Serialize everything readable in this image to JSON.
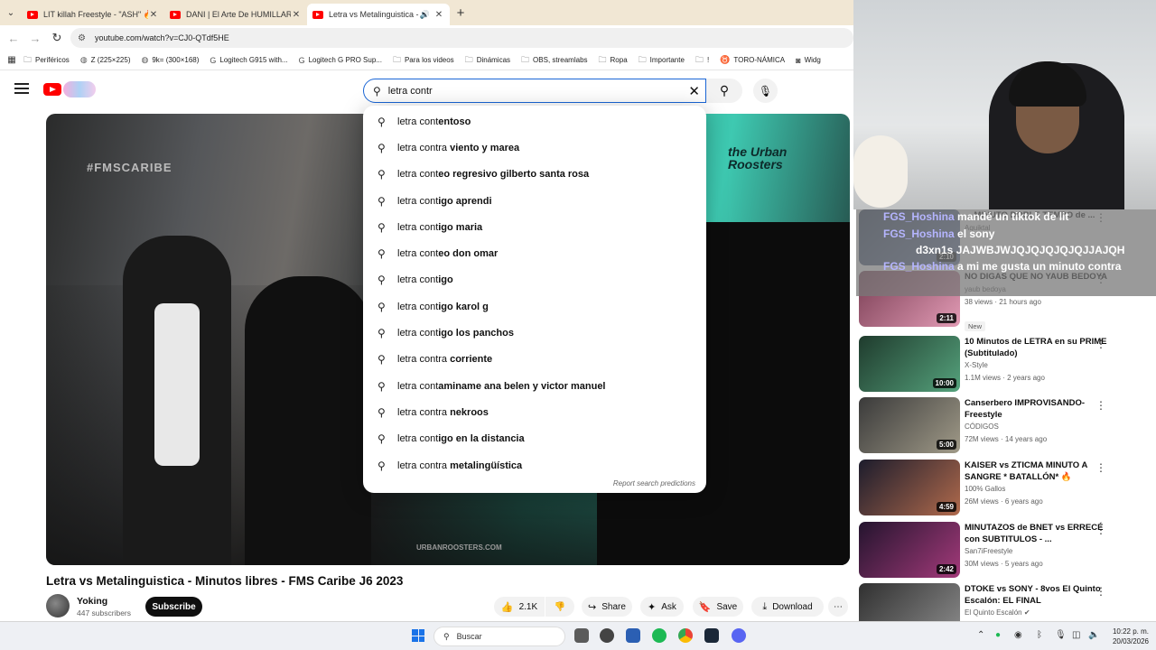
{
  "tabs": [
    {
      "title": "LIT killah Freestyle - \"ASH\" 🔥 -",
      "active": false
    },
    {
      "title": "DANI | El Arte De HUMILLAR Si",
      "active": false
    },
    {
      "title": "Letra vs Metalinguistica - M",
      "active": true
    }
  ],
  "address": {
    "url": "youtube.com/watch?v=CJ0-QTdf5HE"
  },
  "bookmarks": [
    "Periféricos",
    "Z (225×225)",
    "9k= (300×168)",
    "Logitech G915 with...",
    "Logitech G PRO Sup...",
    "Para los videos",
    "Dinámicas",
    "OBS, streamlabs",
    "Ropa",
    "Importante",
    "!",
    "TORO-NÁMICA",
    "Widg"
  ],
  "search": {
    "value": "letra contr"
  },
  "suggestions": [
    {
      "typed": "letra cont",
      "rest": "entoso"
    },
    {
      "typed": "letra contra",
      "rest": " viento y marea"
    },
    {
      "typed": "letra cont",
      "rest": "eo regresivo gilberto santa rosa"
    },
    {
      "typed": "letra cont",
      "rest": "igo aprendi"
    },
    {
      "typed": "letra cont",
      "rest": "igo maria"
    },
    {
      "typed": "letra cont",
      "rest": "eo don omar"
    },
    {
      "typed": "letra cont",
      "rest": "igo"
    },
    {
      "typed": "letra cont",
      "rest": "igo karol g"
    },
    {
      "typed": "letra cont",
      "rest": "igo los panchos"
    },
    {
      "typed": "letra contra",
      "rest": " corriente"
    },
    {
      "typed": "letra cont",
      "rest": "aminame ana belen y victor manuel"
    },
    {
      "typed": "letra contra",
      "rest": " nekroos"
    },
    {
      "typed": "letra cont",
      "rest": "igo en la distancia"
    },
    {
      "typed": "letra contra",
      "rest": " metalingüística"
    }
  ],
  "report_label": "Report search predictions",
  "video": {
    "overlay_left": "#FMSCARIBE",
    "overlay_right": "the Urban Roosters",
    "overlay_bottom": "URBANROOSTERS.COM",
    "title": "Letra vs Metalinguistica - Minutos libres - FMS Caribe J6 2023",
    "channel": "Yoking",
    "subscribers": "447 subscribers",
    "subscribe_label": "Subscribe",
    "likes": "2.1K",
    "share_label": "Share",
    "ask_label": "Ask",
    "save_label": "Save",
    "download_label": "Download"
  },
  "chat_overlay": [
    {
      "name": "FGS_Hoshina",
      "text": "mandé un tiktok de lit"
    },
    {
      "name": "FGS_Hoshina",
      "text": "el sony"
    },
    {
      "name": "",
      "text": "d3xn1s JAJWBJWJQJQJQJQJQJJAJQH"
    },
    {
      "name": "FGS_Hoshina",
      "text": "a mi me gusta un minuto contra"
    }
  ],
  "related": [
    {
      "title": "... MINUTO DOBLE TEMPO de ...",
      "channel": "Aquiktal",
      "views": "",
      "duration": "2:10",
      "new": false
    },
    {
      "title": "NO DIGAS QUE NO YAUB BEDOYA",
      "channel": "yaub bedoya",
      "views": "38 views · 21 hours ago",
      "duration": "2:11",
      "new": true,
      "new_label": "New"
    },
    {
      "title": "10 Minutos de LETRA en su PRIME (Subtitulado)",
      "channel": "X-Style",
      "views": "1.1M views · 2 years ago",
      "duration": "10:00",
      "new": false
    },
    {
      "title": "Canserbero IMPROVISANDO- Freestyle",
      "channel": "CÓDIGOS",
      "views": "72M views · 14 years ago",
      "duration": "5:00",
      "new": false
    },
    {
      "title": "KAISER vs ZTICMA MINUTO A SANGRE * BATALLÓN* 🔥",
      "channel": "100% Gallos",
      "views": "26M views · 6 years ago",
      "duration": "4:59",
      "new": false
    },
    {
      "title": "MINUTAZOS de BNET vs ERRECÉ con SUBTITULOS - ...",
      "channel": "San7iFreestyle",
      "views": "30M views · 5 years ago",
      "duration": "2:42",
      "new": false
    },
    {
      "title": "DTOKE vs SONY - 8vos El Quinto Escalón: EL FINAL",
      "channel": "El Quinto Escalón ✔",
      "views": "",
      "duration": "",
      "new": false
    }
  ],
  "taskbar": {
    "search_placeholder": "Buscar",
    "time": "10:22 p. m.",
    "date": "20/03/2026"
  }
}
